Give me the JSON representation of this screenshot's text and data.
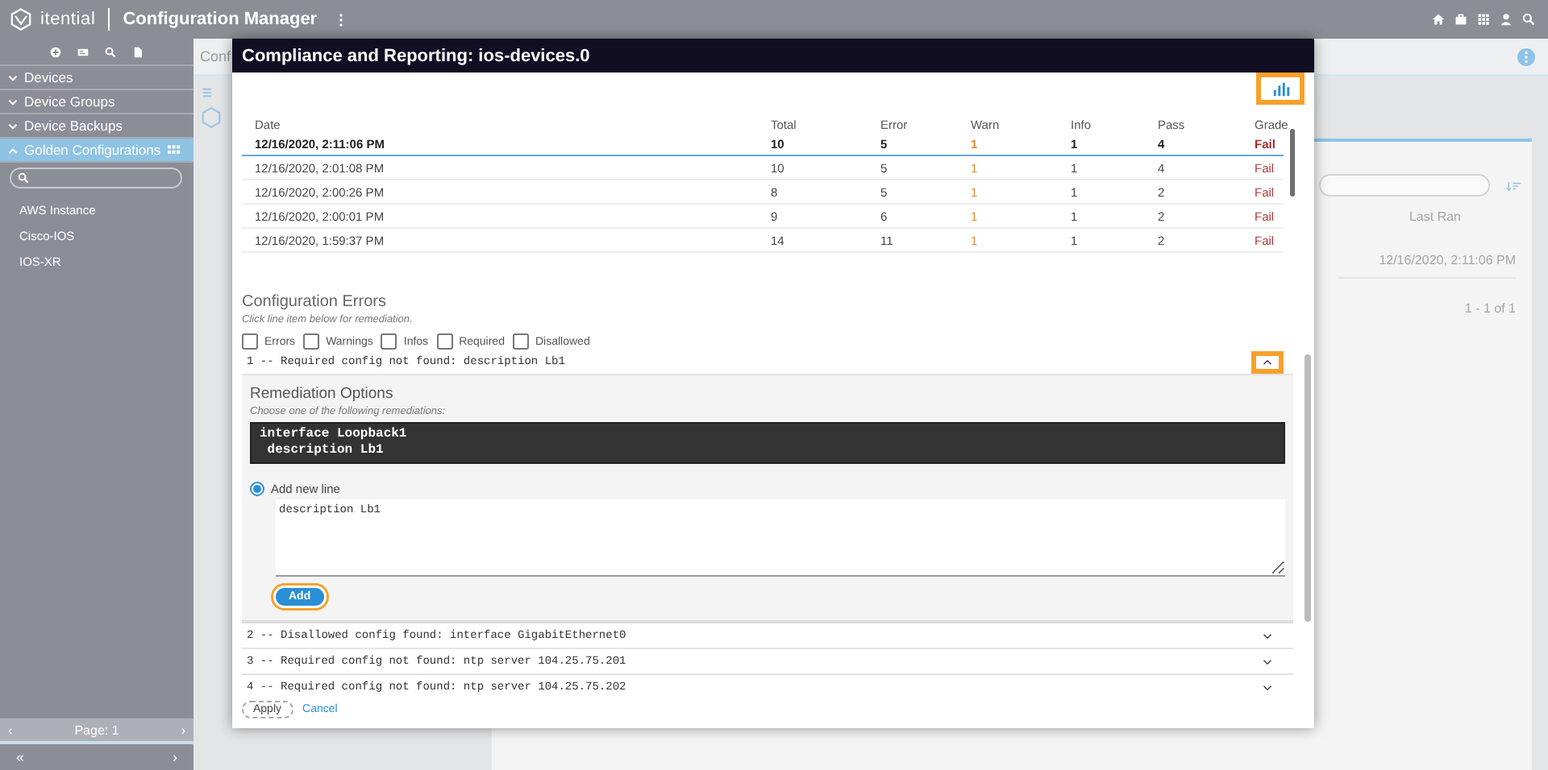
{
  "app": {
    "brand": "itential",
    "title": "Configuration Manager"
  },
  "sidebar": {
    "sections": [
      {
        "label": "Devices",
        "expanded": false,
        "selected": false
      },
      {
        "label": "Device Groups",
        "expanded": false,
        "selected": false
      },
      {
        "label": "Device Backups",
        "expanded": false,
        "selected": false
      },
      {
        "label": "Golden Configurations",
        "expanded": true,
        "selected": true
      }
    ],
    "items": [
      "AWS Instance",
      "Cisco-IOS",
      "IOS-XR"
    ],
    "pager": "Page: 1",
    "prev": "‹",
    "next": "›",
    "collapse": "«",
    "expand": "›"
  },
  "background": {
    "page_title": "Conf",
    "column_header": "Last Ran",
    "last_ran": "12/16/2020, 2:11:06 PM",
    "range": "1 - 1 of 1"
  },
  "modal": {
    "title": "Compliance and Reporting: ios-devices.0",
    "chart_button": {
      "highlighted": true
    },
    "table": {
      "columns": [
        "Date",
        "Total",
        "Error",
        "Warn",
        "Info",
        "Pass",
        "Grade"
      ],
      "summary": [
        "12/16/2020, 2:11:06 PM",
        "10",
        "5",
        "1",
        "1",
        "4",
        "Fail"
      ],
      "rows": [
        [
          "12/16/2020, 2:01:08 PM",
          "10",
          "5",
          "1",
          "1",
          "4",
          "Fail"
        ],
        [
          "12/16/2020, 2:00:26 PM",
          "8",
          "5",
          "1",
          "1",
          "2",
          "Fail"
        ],
        [
          "12/16/2020, 2:00:01 PM",
          "9",
          "6",
          "1",
          "1",
          "2",
          "Fail"
        ],
        [
          "12/16/2020, 1:59:37 PM",
          "14",
          "11",
          "1",
          "1",
          "2",
          "Fail"
        ]
      ]
    },
    "errors_title": "Configuration Errors",
    "errors_hint": "Click line item below for remediation.",
    "filters": [
      {
        "label": "Errors",
        "checked": false
      },
      {
        "label": "Warnings",
        "checked": false
      },
      {
        "label": "Infos",
        "checked": false
      },
      {
        "label": "Required",
        "checked": false
      },
      {
        "label": "Disallowed",
        "checked": false
      }
    ],
    "errors": [
      {
        "text": "1 -- Required config not found: description Lb1",
        "expanded": true,
        "highlighted": true
      },
      {
        "text": "2 -- Disallowed config found: interface GigabitEthernet0",
        "expanded": false,
        "highlighted": false
      },
      {
        "text": "3 -- Required config not found: ntp server 104.25.75.201",
        "expanded": false,
        "highlighted": false
      },
      {
        "text": "4 -- Required config not found: ntp server 104.25.75.202",
        "expanded": false,
        "highlighted": false
      }
    ],
    "remediation": {
      "title": "Remediation Options",
      "hint": "Choose one of the following remediations:",
      "code": [
        "interface Loopback1",
        " description Lb1"
      ],
      "options": [
        {
          "label": "Add new line",
          "selected": true
        }
      ],
      "value": "description Lb1",
      "button": {
        "label": "Add",
        "highlighted": true
      }
    },
    "footer": {
      "apply": "Apply",
      "cancel": "Cancel"
    }
  }
}
